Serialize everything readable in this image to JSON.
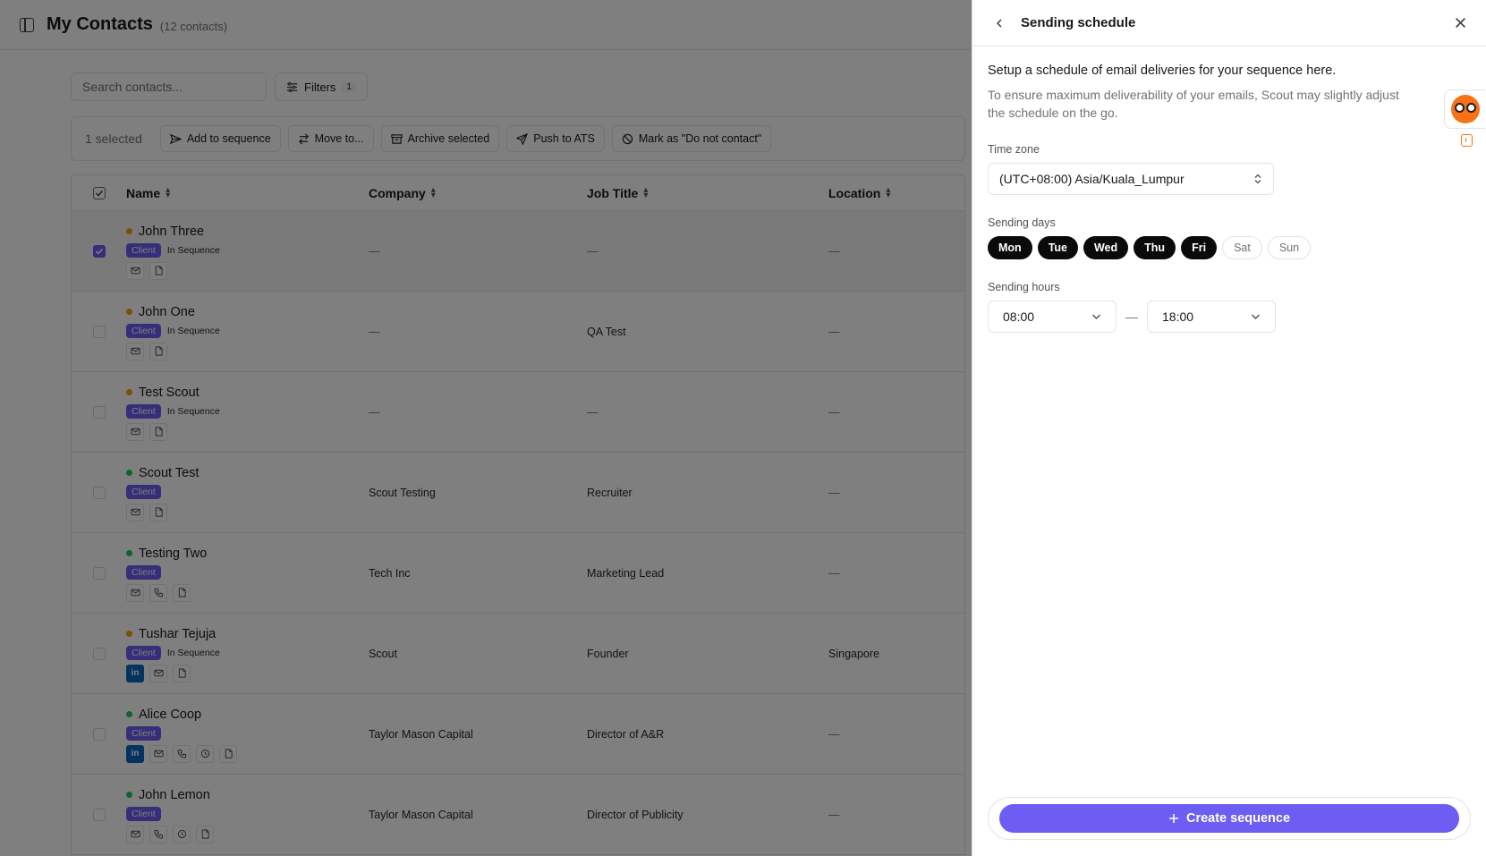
{
  "app": {
    "page_title": "My Contacts",
    "contacts_count": "(12 contacts)",
    "search_placeholder": "Search contacts...",
    "filters_label": "Filters",
    "filters_count": "1"
  },
  "bulk": {
    "selected_text": "1 selected",
    "actions": [
      "Add to sequence",
      "Move to...",
      "Archive selected",
      "Push to ATS",
      "Mark as \"Do not contact\""
    ]
  },
  "table": {
    "columns": [
      "Name",
      "Company",
      "Job Title",
      "Location"
    ],
    "client_label": "Client",
    "sequence_label": "In Sequence",
    "rows": [
      {
        "name": "John Three",
        "status": "amber",
        "in_sequence": true,
        "selected": true,
        "company": "—",
        "job": "—",
        "location": "—",
        "icons": [
          "mail",
          "note"
        ]
      },
      {
        "name": "John One",
        "status": "amber",
        "in_sequence": true,
        "selected": false,
        "company": "—",
        "job": "QA Test",
        "location": "—",
        "icons": [
          "mail",
          "note"
        ]
      },
      {
        "name": "Test Scout",
        "status": "amber",
        "in_sequence": true,
        "selected": false,
        "company": "—",
        "job": "—",
        "location": "—",
        "icons": [
          "mail",
          "note"
        ]
      },
      {
        "name": "Scout Test",
        "status": "green",
        "in_sequence": false,
        "selected": false,
        "company": "Scout Testing",
        "job": "Recruiter",
        "location": "—",
        "icons": [
          "mail",
          "note"
        ]
      },
      {
        "name": "Testing Two",
        "status": "green",
        "in_sequence": false,
        "selected": false,
        "company": "Tech Inc",
        "job": "Marketing Lead",
        "location": "—",
        "icons": [
          "mail",
          "phone",
          "note"
        ]
      },
      {
        "name": "Tushar Tejuja",
        "status": "amber",
        "in_sequence": true,
        "selected": false,
        "company": "Scout",
        "job": "Founder",
        "location": "Singapore",
        "icons": [
          "linkedin",
          "mail",
          "note"
        ]
      },
      {
        "name": "Alice Coop",
        "status": "green",
        "in_sequence": false,
        "selected": false,
        "company": "Taylor Mason Capital",
        "job": "Director of A&R",
        "location": "—",
        "icons": [
          "linkedin",
          "mail",
          "phone",
          "clock",
          "note"
        ]
      },
      {
        "name": "John Lemon",
        "status": "green",
        "in_sequence": false,
        "selected": false,
        "company": "Taylor Mason Capital",
        "job": "Director of Publicity",
        "location": "—",
        "icons": [
          "mail",
          "phone",
          "clock",
          "note"
        ]
      }
    ]
  },
  "panel": {
    "title": "Sending schedule",
    "intro": "Setup a schedule of email deliveries for your sequence here.",
    "intro_sub": "To ensure maximum deliverability of your emails, Scout may slightly adjust the schedule on the go.",
    "timezone_label": "Time zone",
    "timezone_value": "(UTC+08:00) Asia/Kuala_Lumpur",
    "days_label": "Sending days",
    "days": [
      {
        "label": "Mon",
        "on": true
      },
      {
        "label": "Tue",
        "on": true
      },
      {
        "label": "Wed",
        "on": true
      },
      {
        "label": "Thu",
        "on": true
      },
      {
        "label": "Fri",
        "on": true
      },
      {
        "label": "Sat",
        "on": false
      },
      {
        "label": "Sun",
        "on": false
      }
    ],
    "hours_label": "Sending hours",
    "hours_from": "08:00",
    "hours_separator": "—",
    "hours_to": "18:00",
    "create_label": "Create sequence"
  },
  "colors": {
    "accent": "#6d5df2",
    "status_amber": "#f59e0b",
    "status_green": "#22c55e",
    "assistant_orange": "#f97316"
  }
}
